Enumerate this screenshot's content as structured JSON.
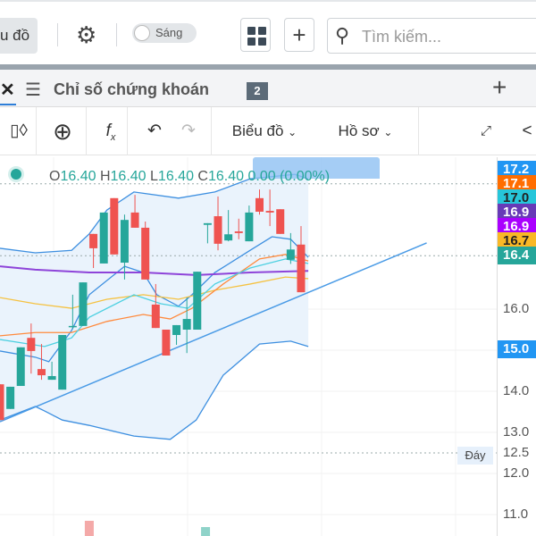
{
  "topbar": {
    "chart_button": "u đồ",
    "theme_toggle": "Sáng",
    "search_placeholder": "Tìm kiếm..."
  },
  "tabbar": {
    "title": "Chỉ số chứng khoán",
    "badge": "2"
  },
  "toolbar": {
    "chart_menu": "Biểu đồ",
    "profile_menu": "Hồ sơ"
  },
  "legend": {
    "o_label": "O",
    "o": "16.40",
    "h_label": "H",
    "h": "16.40",
    "l_label": "L",
    "l": "16.40",
    "c_label": "C",
    "c": "16.40",
    "change": "0.00 (0.00%)"
  },
  "colors": {
    "up": "#26a69a",
    "down": "#ef5350",
    "band": "#3d8fe0",
    "band_fill": "#eaf3fc",
    "cyan": "#4dd0e1",
    "orange": "#ff8a3d",
    "yellow": "#f5c242",
    "purple": "#8e44d9"
  },
  "price_axis": [
    {
      "text": "17.2",
      "price": 19.4,
      "bg": "#2196f3",
      "fg": "#ffffff"
    },
    {
      "text": "17.1",
      "price": 19.05,
      "bg": "#ff6d00",
      "fg": "#ffffff"
    },
    {
      "text": "17.0",
      "price": 18.7,
      "bg": "#26c6da",
      "fg": "#222222"
    },
    {
      "text": "16.9",
      "price": 18.35,
      "bg": "#673ab7",
      "fg": "#ffffff"
    },
    {
      "text": "16.9",
      "price": 18.0,
      "bg": "#aa00ff",
      "fg": "#ffffff"
    },
    {
      "text": "16.7",
      "price": 17.65,
      "bg": "#f9b826",
      "fg": "#222222"
    },
    {
      "text": "16.4",
      "price": 17.3,
      "bg": "#26a69a",
      "fg": "#ffffff"
    },
    {
      "text": "16.0",
      "price": 16.0,
      "bg": "",
      "fg": "#555555"
    },
    {
      "text": "15.0",
      "price": 15.03,
      "bg": "#2196f3",
      "fg": "#ffffff"
    },
    {
      "text": "14.0",
      "price": 14.0,
      "bg": "",
      "fg": "#555555"
    },
    {
      "text": "13.0",
      "price": 13.0,
      "bg": "",
      "fg": "#555555"
    },
    {
      "text": "12.5",
      "price": 12.5,
      "bg": "",
      "fg": "#555555"
    },
    {
      "text": "12.0",
      "price": 12.0,
      "bg": "",
      "fg": "#555555"
    },
    {
      "text": "11.0",
      "price": 11.0,
      "bg": "",
      "fg": "#555555"
    }
  ],
  "bottom_label": "Đáy",
  "chart_data": {
    "type": "candlestick",
    "ylim": [
      10.5,
      19.6
    ],
    "xlim": [
      -0.4,
      47.5
    ],
    "candles": [
      [
        14.17,
        14.17,
        13.3,
        13.3
      ],
      [
        13.57,
        14.11,
        13.57,
        14.11
      ],
      [
        14.13,
        15.07,
        14.13,
        15.07
      ],
      [
        15.3,
        15.65,
        14.43,
        14.98
      ],
      [
        14.54,
        15.15,
        14.28,
        14.39
      ],
      [
        14.28,
        14.72,
        14.28,
        14.37
      ],
      [
        14.04,
        15.37,
        14.04,
        15.37
      ],
      [
        15.59,
        16.35,
        15.52,
        15.59
      ],
      [
        15.59,
        16.65,
        15.59,
        16.65
      ],
      [
        17.83,
        17.83,
        17.0,
        17.48
      ],
      [
        17.11,
        18.35,
        17.11,
        18.35
      ],
      [
        18.7,
        18.7,
        17.33,
        17.33
      ],
      [
        17.13,
        18.3,
        16.72,
        18.17
      ],
      [
        18.35,
        18.78,
        17.98,
        17.98
      ],
      [
        17.98,
        18.13,
        16.72,
        16.72
      ],
      [
        16.11,
        16.61,
        15.54,
        15.54
      ],
      [
        15.5,
        15.5,
        14.87,
        14.87
      ],
      [
        15.37,
        15.61,
        15.13,
        15.61
      ],
      [
        15.5,
        16.28,
        14.93,
        15.76
      ],
      [
        15.5,
        16.91,
        15.5,
        16.91
      ],
      [
        18.05,
        18.09,
        17.6,
        18.09
      ],
      [
        18.26,
        18.74,
        17.43,
        17.59
      ],
      [
        17.67,
        18.41,
        17.65,
        17.82
      ],
      [
        17.89,
        18.2,
        17.7,
        17.85
      ],
      [
        17.65,
        18.52,
        17.65,
        18.35
      ],
      [
        18.7,
        18.91,
        18.3,
        18.37
      ],
      [
        18.39,
        18.91,
        18.02,
        18.35
      ],
      [
        18.43,
        18.43,
        17.83,
        17.83
      ],
      [
        17.2,
        17.85,
        17.1,
        17.45
      ],
      [
        17.57,
        18.02,
        16.41,
        16.41
      ]
    ],
    "upper_band": [
      [
        0,
        17.48
      ],
      [
        3.4,
        17.37
      ],
      [
        6.9,
        17.43
      ],
      [
        8.6,
        17.83
      ],
      [
        10.3,
        18.41
      ],
      [
        12.9,
        18.85
      ],
      [
        17.2,
        18.7
      ],
      [
        20.7,
        18.85
      ],
      [
        24.1,
        19.17
      ],
      [
        28.4,
        19.28
      ],
      [
        29.7,
        19.17
      ]
    ],
    "lower_band": [
      [
        0,
        13.3
      ],
      [
        3.4,
        13.63
      ],
      [
        4.3,
        13.52
      ],
      [
        6,
        13.3
      ],
      [
        8.6,
        13.17
      ],
      [
        12.9,
        12.91
      ],
      [
        16.4,
        12.83
      ],
      [
        18.9,
        13.3
      ],
      [
        21.5,
        14.39
      ],
      [
        25,
        15.15
      ],
      [
        28,
        15.22
      ],
      [
        29.7,
        15.09
      ]
    ],
    "mid_band": [
      [
        0,
        14.98
      ],
      [
        3.4,
        14.83
      ],
      [
        4.7,
        14.72
      ],
      [
        6.9,
        15.48
      ],
      [
        8.6,
        16.35
      ],
      [
        12,
        17.04
      ],
      [
        13.8,
        16.89
      ],
      [
        15.1,
        16.35
      ],
      [
        17.2,
        16.07
      ],
      [
        18.5,
        16.35
      ],
      [
        20.7,
        16.89
      ],
      [
        24.1,
        17.43
      ],
      [
        26.2,
        17.76
      ],
      [
        28,
        17.7
      ],
      [
        29.7,
        17.26
      ]
    ],
    "ma_cyan": [
      [
        0,
        15.26
      ],
      [
        4.3,
        15.09
      ],
      [
        6.9,
        15.3
      ],
      [
        8.6,
        15.8
      ],
      [
        12.9,
        16.35
      ],
      [
        15.5,
        16.13
      ],
      [
        18.1,
        16.02
      ],
      [
        20.7,
        16.61
      ],
      [
        24.1,
        17.0
      ],
      [
        27.5,
        17.22
      ],
      [
        29.7,
        17.11
      ]
    ],
    "ma_orange": [
      [
        0,
        15.35
      ],
      [
        3.4,
        15.43
      ],
      [
        6.9,
        15.43
      ],
      [
        10.3,
        15.7
      ],
      [
        13.8,
        15.87
      ],
      [
        16.4,
        15.76
      ],
      [
        18.5,
        16.02
      ],
      [
        21.5,
        16.61
      ],
      [
        25,
        17.22
      ],
      [
        27.5,
        17.33
      ],
      [
        29.7,
        17.17
      ]
    ],
    "ma_yellow": [
      [
        0,
        16.28
      ],
      [
        3.4,
        16.13
      ],
      [
        6.9,
        16.02
      ],
      [
        10.3,
        16.24
      ],
      [
        13.8,
        16.35
      ],
      [
        17.2,
        16.24
      ],
      [
        20.7,
        16.46
      ],
      [
        24.1,
        16.61
      ],
      [
        27.5,
        16.78
      ],
      [
        29.7,
        16.74
      ]
    ],
    "ma_purple": [
      [
        0,
        17.04
      ],
      [
        3.4,
        16.96
      ],
      [
        8.6,
        16.89
      ],
      [
        13.8,
        16.89
      ],
      [
        18.9,
        16.83
      ],
      [
        24.1,
        16.89
      ],
      [
        29.7,
        16.93
      ]
    ],
    "trendline": [
      [
        0,
        13.26
      ],
      [
        41.1,
        17.61
      ]
    ],
    "hlines": [
      19.05,
      17.3,
      12.5
    ],
    "volume": [
      {
        "bar": 8.6,
        "dir": "down"
      },
      {
        "bar": 19.8,
        "dir": "up"
      }
    ]
  }
}
